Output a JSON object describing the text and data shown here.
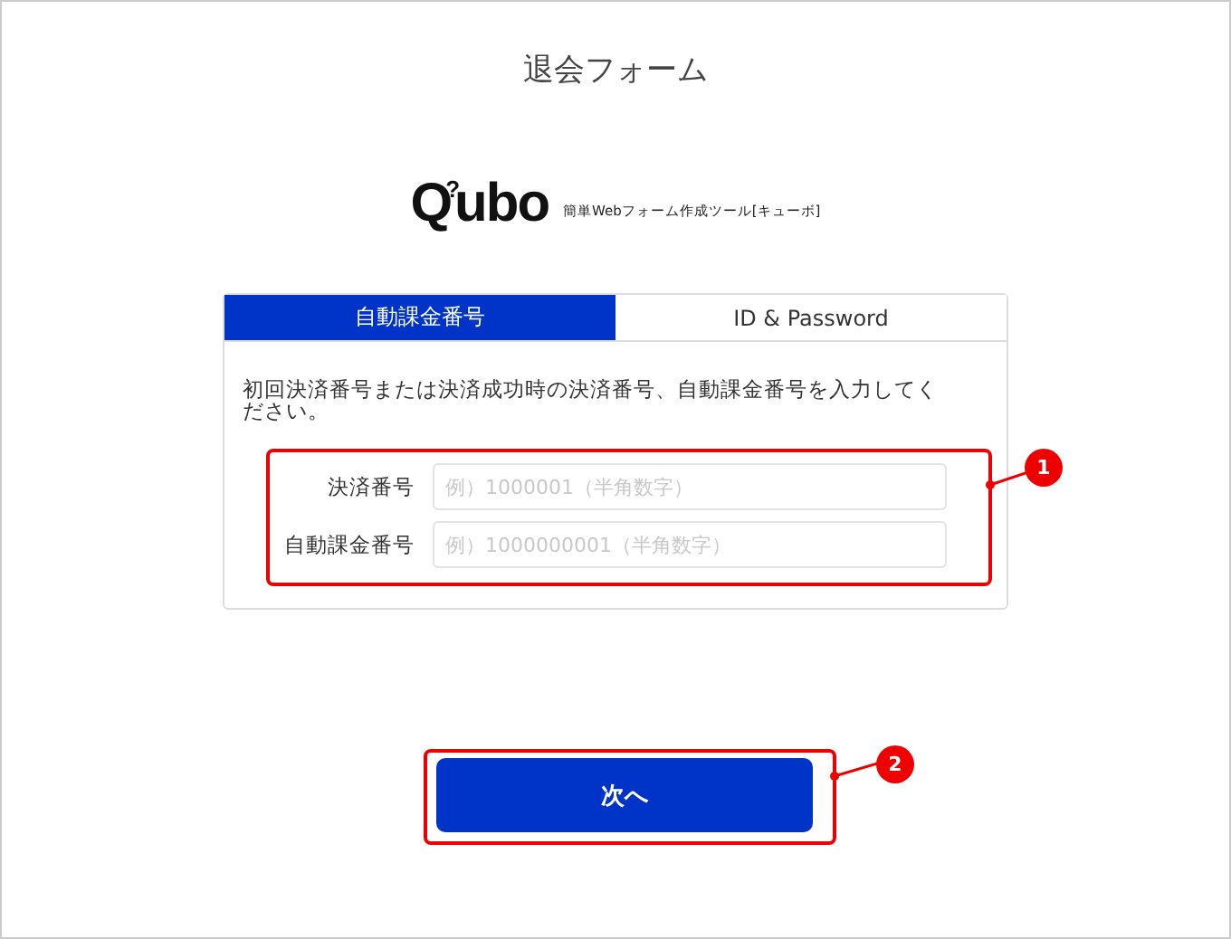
{
  "page_title": "退会フォーム",
  "logo": {
    "initial": "Q",
    "mark": "?",
    "rest": "ubo",
    "tagline": "簡単Webフォーム作成ツール[キューボ]"
  },
  "tabs": [
    {
      "label": "自動課金番号",
      "selected": true
    },
    {
      "label": "ID & Password",
      "selected": false
    }
  ],
  "description": "初回決済番号または決済成功時の決済番号、自動課金番号を入力してください。",
  "fields": [
    {
      "label": "決済番号",
      "placeholder": "例）1000001（半角数字）"
    },
    {
      "label": "自動課金番号",
      "placeholder": "例）1000000001（半角数字）"
    }
  ],
  "next_button": "次へ",
  "callouts": [
    {
      "number": "1"
    },
    {
      "number": "2"
    }
  ]
}
